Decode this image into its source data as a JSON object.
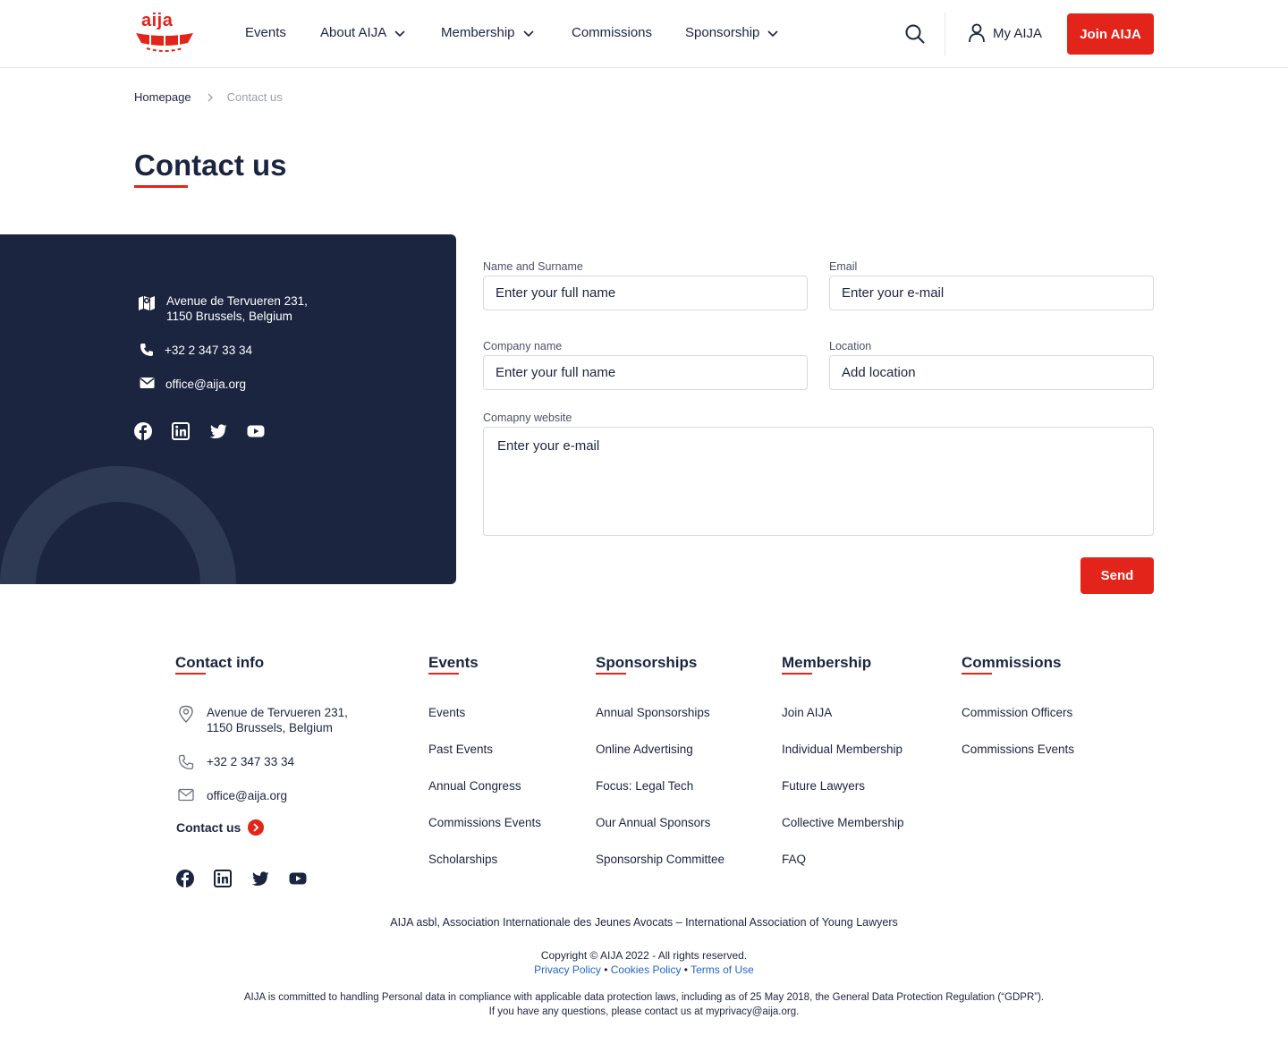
{
  "brand": {
    "logo_text": "aija",
    "accent": "#e3241b",
    "navy": "#1b2540"
  },
  "nav": {
    "items": [
      {
        "label": "Events",
        "dropdown": false
      },
      {
        "label": "About AIJA",
        "dropdown": true
      },
      {
        "label": "Membership",
        "dropdown": true
      },
      {
        "label": "Commissions",
        "dropdown": false
      },
      {
        "label": "Sponsorship",
        "dropdown": true
      }
    ],
    "my_account": "My AIJA",
    "join": "Join AIJA"
  },
  "breadcrumb": {
    "home": "Homepage",
    "current": "Contact us"
  },
  "page_title": "Contact us",
  "contact_panel": {
    "address_line1": "Avenue de Tervueren 231,",
    "address_line2": "1150 Brussels, Belgium",
    "phone": "+32 2 347 33 34",
    "email": "office@aija.org",
    "social": [
      "facebook-icon",
      "linkedin-icon",
      "twitter-icon",
      "youtube-icon"
    ]
  },
  "form": {
    "name": {
      "label": "Name and Surname",
      "placeholder": "Enter your full name"
    },
    "email": {
      "label": "Email",
      "placeholder": "Enter your e-mail"
    },
    "company": {
      "label": "Company name",
      "placeholder": "Enter your full name"
    },
    "location": {
      "label": "Location",
      "placeholder": "Add location"
    },
    "website": {
      "label": "Comapny website",
      "placeholder": "Enter your e-mail"
    },
    "send": "Send"
  },
  "footer": {
    "contact": {
      "heading": "Contact info",
      "address_line1": "Avenue de Tervueren 231,",
      "address_line2": "1150 Brussels, Belgium",
      "phone": "+32 2 347 33 34",
      "email": "office@aija.org",
      "contact_link": "Contact us"
    },
    "columns": [
      {
        "heading": "Events",
        "links": [
          "Events",
          "Past Events",
          "Annual Congress",
          "Commissions Events",
          "Scholarships"
        ]
      },
      {
        "heading": "Sponsorships",
        "links": [
          "Annual Sponsorships",
          "Online Advertising",
          "Focus: Legal Tech",
          "Our Annual Sponsors",
          "Sponsorship Committee"
        ]
      },
      {
        "heading": "Membership",
        "links": [
          "Join AIJA",
          "Individual Membership",
          "Future Lawyers",
          "Collective Membership",
          "FAQ"
        ]
      },
      {
        "heading": "Commissions",
        "links": [
          "Commission Officers",
          "Commissions Events"
        ]
      }
    ],
    "association": "AIJA asbl, Association Internationale des Jeunes Avocats – International Association of Young Lawyers",
    "copyright": "Copyright © AIJA 2022 - All rights reserved.",
    "legal_links": [
      "Privacy Policy",
      "Cookies Policy",
      "Terms of Use"
    ],
    "gdpr_line1": "AIJA is committed to handling Personal data in compliance with applicable data protection laws, including as of 25 May 2018, the General Data Protection Regulation (“GDPR”).",
    "gdpr_line2": "If you have any questions, please contact us at myprivacy@aija.org."
  }
}
